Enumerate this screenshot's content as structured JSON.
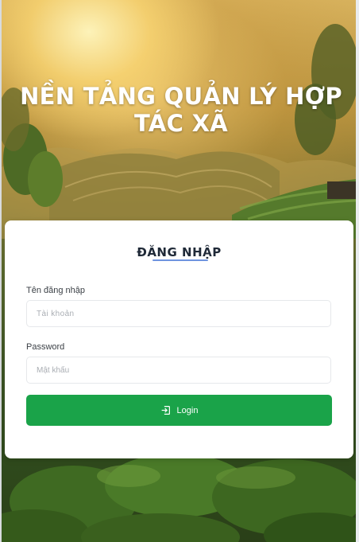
{
  "hero": {
    "title": "NỀN TẢNG QUẢN LÝ HỢP TÁC XÃ"
  },
  "login_card": {
    "heading": "ĐĂNG NHẬP",
    "username": {
      "label": "Tên đăng nhập",
      "placeholder": "Tài khoản",
      "value": ""
    },
    "password": {
      "label": "Password",
      "placeholder": "Mật khẩu",
      "value": ""
    },
    "login_button": {
      "label": "Login",
      "icon": "login-icon"
    }
  },
  "colors": {
    "button_green": "#1aa349",
    "heading_underline": "#6f94e0",
    "title_text": "#ffffff"
  }
}
